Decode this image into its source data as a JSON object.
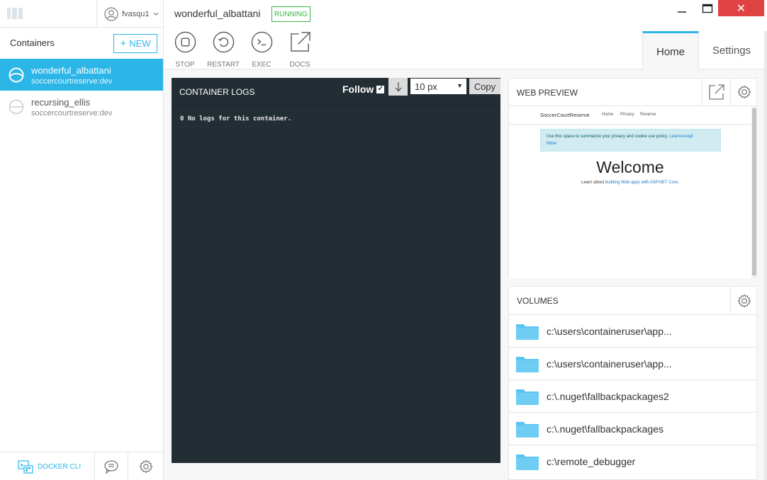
{
  "sidebar": {
    "username": "fvasqu1",
    "containers_title": "Containers",
    "new_button": "NEW",
    "containers": [
      {
        "name": "wonderful_albattani",
        "image": "soccercourtreserve:dev"
      },
      {
        "name": "recursing_ellis",
        "image": "soccercourtreserve:dev"
      }
    ],
    "docker_cli_label": "DOCKER CLI"
  },
  "header": {
    "container_name": "wonderful_albattani",
    "status": "RUNNING",
    "actions": {
      "stop": "STOP",
      "restart": "RESTART",
      "exec": "EXEC",
      "docs": "DOCS"
    },
    "tabs": {
      "home": "Home",
      "settings": "Settings"
    },
    "close_glyph": "✕"
  },
  "logs": {
    "title": "CONTAINER LOGS",
    "follow_label": "Follow",
    "font_size_value": "10 px",
    "copy_label": "Copy",
    "text": "0 No logs for this container."
  },
  "preview": {
    "title": "WEB PREVIEW",
    "site": {
      "brand": "SoccerCourtReserve",
      "nav": [
        "Home",
        "Privacy",
        "Reverse"
      ],
      "cookie_text": "Use this space to summarize your privacy and cookie use policy.",
      "cookie_link": "Learn",
      "cookie_accept": "Accept",
      "cookie_more": "More.",
      "welcome": "Welcome",
      "learn_prefix": "Learn about",
      "learn_link": "building Web apps with ASP.NET Core",
      "learn_suffix": "."
    }
  },
  "volumes": {
    "title": "VOLUMES",
    "items": [
      "c:\\users\\containeruser\\app...",
      "c:\\users\\containeruser\\app...",
      "c:\\.nuget\\fallbackpackages2",
      "c:\\.nuget\\fallbackpackages",
      "c:\\remote_debugger"
    ]
  },
  "colors": {
    "accent": "#2bb6e7",
    "running": "#3ab34a",
    "logs_bg": "#232e34",
    "close": "#e04343",
    "folder": "#5bc4f1"
  }
}
